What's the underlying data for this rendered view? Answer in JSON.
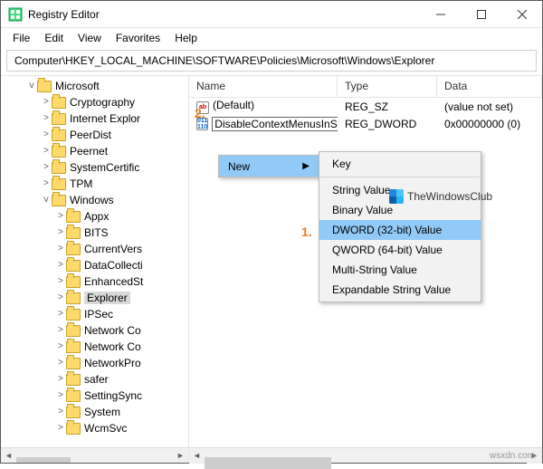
{
  "window": {
    "title": "Registry Editor"
  },
  "menu": {
    "file": "File",
    "edit": "Edit",
    "view": "View",
    "favorites": "Favorites",
    "help": "Help"
  },
  "address": {
    "path": "Computer\\HKEY_LOCAL_MACHINE\\SOFTWARE\\Policies\\Microsoft\\Windows\\Explorer"
  },
  "tree": {
    "microsoft": "Microsoft",
    "items1": [
      "Cryptography",
      "Internet Explor",
      "PeerDist",
      "Peernet",
      "SystemCertific",
      "TPM"
    ],
    "windows": "Windows",
    "items2": [
      "Appx",
      "BITS",
      "CurrentVers",
      "DataCollecti",
      "EnhancedSt",
      "Explorer",
      "IPSec",
      "Network Co",
      "Network Co",
      "NetworkPro",
      "safer",
      "SettingSync",
      "System",
      "WcmSvc"
    ]
  },
  "columns": {
    "name": "Name",
    "type": "Type",
    "data": "Data"
  },
  "rows": {
    "r0": {
      "name": "(Default)",
      "type": "REG_SZ",
      "data": "(value not set)"
    },
    "r1": {
      "name": "DisableContextMenusInStart",
      "type": "REG_DWORD",
      "data": "0x00000000 (0)"
    }
  },
  "ctx": {
    "new": "New",
    "key": "Key",
    "string": "String Value",
    "binary": "Binary Value",
    "dword": "DWORD (32-bit) Value",
    "qword": "QWORD (64-bit) Value",
    "multi": "Multi-String Value",
    "expand": "Expandable String Value"
  },
  "annot": {
    "one": "1.",
    "two": "2."
  },
  "watermark": {
    "text": "TheWindowsClub"
  },
  "credit": {
    "text": "wsxdn.com"
  }
}
